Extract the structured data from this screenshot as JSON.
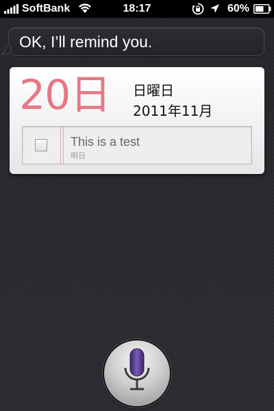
{
  "status_bar": {
    "carrier": "SoftBank",
    "time": "18:17",
    "battery_percent": "60%",
    "icons": [
      "signal-icon",
      "wifi-icon",
      "orientation-lock-icon",
      "location-icon",
      "battery-icon"
    ]
  },
  "siri": {
    "response": "OK, I’ll remind you."
  },
  "card": {
    "day": "20日",
    "weekday": "日曜日",
    "month_year": "2011年11月",
    "accent_color": "#e57885",
    "reminder": {
      "title": "This is a test",
      "due": "明日",
      "checked": false
    }
  },
  "mic": {
    "icon": "microphone-icon",
    "accent_color": "#5a3f8a"
  }
}
